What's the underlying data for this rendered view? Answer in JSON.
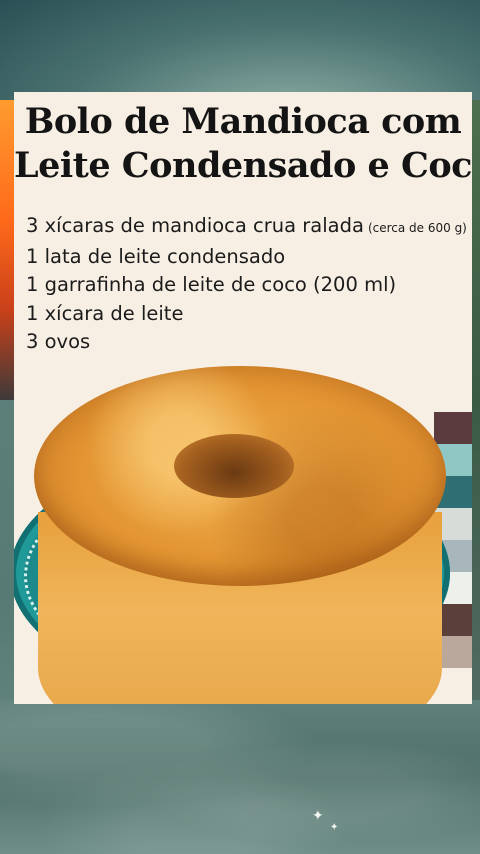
{
  "recipe": {
    "title_line1": "Bolo de Mandioca com",
    "title_line2": "Leite Condensado e Coco",
    "ingredients": [
      {
        "text": "3 xícaras de mandioca crua ralada",
        "note": "(cerca de 600 g)"
      },
      {
        "text": "1 lata de leite condensado"
      },
      {
        "text": "1 garrafinha de leite de coco (200 ml)"
      },
      {
        "text": "1 xícara de leite"
      },
      {
        "text": "3 ovos"
      }
    ]
  }
}
